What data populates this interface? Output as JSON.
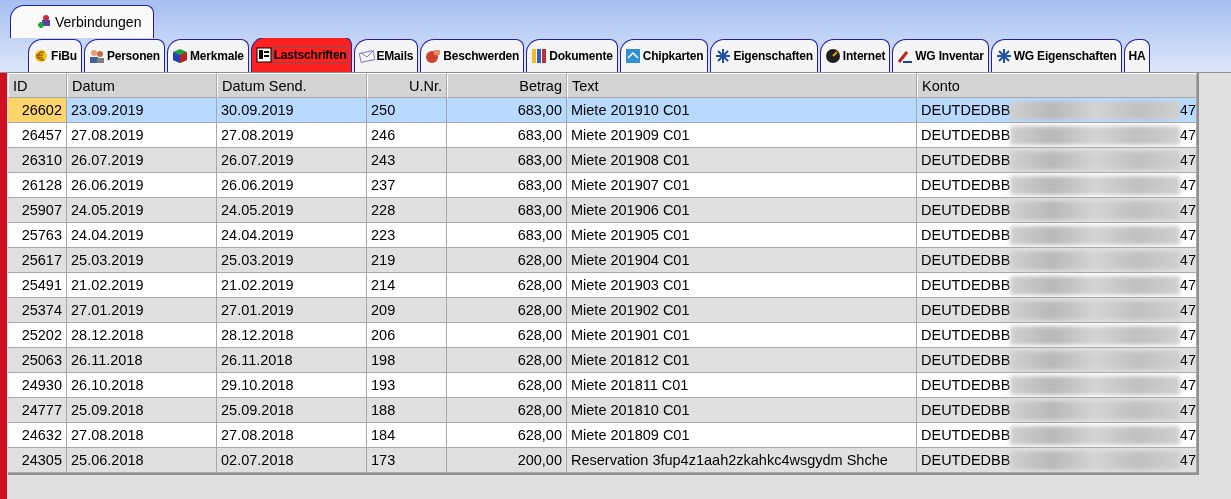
{
  "top_tabs": [
    {
      "label": "Verbindungen",
      "selected": true
    }
  ],
  "tabs": [
    {
      "label": "FiBu",
      "selected": false
    },
    {
      "label": "Personen",
      "selected": false
    },
    {
      "label": "Merkmale",
      "selected": false
    },
    {
      "label": "Lastschriften",
      "selected": true
    },
    {
      "label": "EMails",
      "selected": false
    },
    {
      "label": "Beschwerden",
      "selected": false
    },
    {
      "label": "Dokumente",
      "selected": false
    },
    {
      "label": "Chipkarten",
      "selected": false
    },
    {
      "label": "Eigenschaften",
      "selected": false
    },
    {
      "label": "Internet",
      "selected": false
    },
    {
      "label": "WG Inventar",
      "selected": false
    },
    {
      "label": "WG Eigenschaften",
      "selected": false
    },
    {
      "label": "HA",
      "selected": false
    }
  ],
  "table": {
    "columns": [
      "ID",
      "Datum",
      "Datum Send.",
      "U.Nr.",
      "Betrag",
      "Text",
      "Konto"
    ],
    "rows": [
      {
        "selected": true,
        "cells": [
          "26602",
          "23.09.2019",
          "30.09.2019",
          "250",
          "683,00",
          "Miete 201910 C01",
          "DEUTDEDBB",
          "47"
        ]
      },
      {
        "selected": false,
        "cells": [
          "26457",
          "27.08.2019",
          "27.08.2019",
          "246",
          "683,00",
          "Miete 201909 C01",
          "DEUTDEDBB",
          "47"
        ]
      },
      {
        "selected": false,
        "cells": [
          "26310",
          "26.07.2019",
          "26.07.2019",
          "243",
          "683,00",
          "Miete 201908 C01",
          "DEUTDEDBB",
          "47"
        ]
      },
      {
        "selected": false,
        "cells": [
          "26128",
          "26.06.2019",
          "26.06.2019",
          "237",
          "683,00",
          "Miete 201907 C01",
          "DEUTDEDBB",
          "47"
        ]
      },
      {
        "selected": false,
        "cells": [
          "25907",
          "24.05.2019",
          "24.05.2019",
          "228",
          "683,00",
          "Miete 201906 C01",
          "DEUTDEDBB",
          "47"
        ]
      },
      {
        "selected": false,
        "cells": [
          "25763",
          "24.04.2019",
          "24.04.2019",
          "223",
          "683,00",
          "Miete 201905 C01",
          "DEUTDEDBB",
          "47"
        ]
      },
      {
        "selected": false,
        "cells": [
          "25617",
          "25.03.2019",
          "25.03.2019",
          "219",
          "628,00",
          "Miete 201904 C01",
          "DEUTDEDBB",
          "47"
        ]
      },
      {
        "selected": false,
        "cells": [
          "25491",
          "21.02.2019",
          "21.02.2019",
          "214",
          "628,00",
          "Miete 201903 C01",
          "DEUTDEDBB",
          "47"
        ]
      },
      {
        "selected": false,
        "cells": [
          "25374",
          "27.01.2019",
          "27.01.2019",
          "209",
          "628,00",
          "Miete 201902 C01",
          "DEUTDEDBB",
          "47"
        ]
      },
      {
        "selected": false,
        "cells": [
          "25202",
          "28.12.2018",
          "28.12.2018",
          "206",
          "628,00",
          "Miete 201901 C01",
          "DEUTDEDBB",
          "47"
        ]
      },
      {
        "selected": false,
        "cells": [
          "25063",
          "26.11.2018",
          "26.11.2018",
          "198",
          "628,00",
          "Miete 201812 C01",
          "DEUTDEDBB",
          "47"
        ]
      },
      {
        "selected": false,
        "cells": [
          "24930",
          "26.10.2018",
          "29.10.2018",
          "193",
          "628,00",
          "Miete 201811 C01",
          "DEUTDEDBB",
          "47"
        ]
      },
      {
        "selected": false,
        "cells": [
          "24777",
          "25.09.2018",
          "25.09.2018",
          "188",
          "628,00",
          "Miete 201810 C01",
          "DEUTDEDBB",
          "47"
        ]
      },
      {
        "selected": false,
        "cells": [
          "24632",
          "27.08.2018",
          "27.08.2018",
          "184",
          "628,00",
          "Miete 201809 C01",
          "DEUTDEDBB",
          "47"
        ]
      },
      {
        "selected": false,
        "cells": [
          "24305",
          "25.06.2018",
          "02.07.2018",
          "173",
          "200,00",
          "Reservation 3fup4z1aah2zkahkc4wsgydm Shche",
          "DEUTDEDBB",
          "47"
        ]
      }
    ]
  }
}
